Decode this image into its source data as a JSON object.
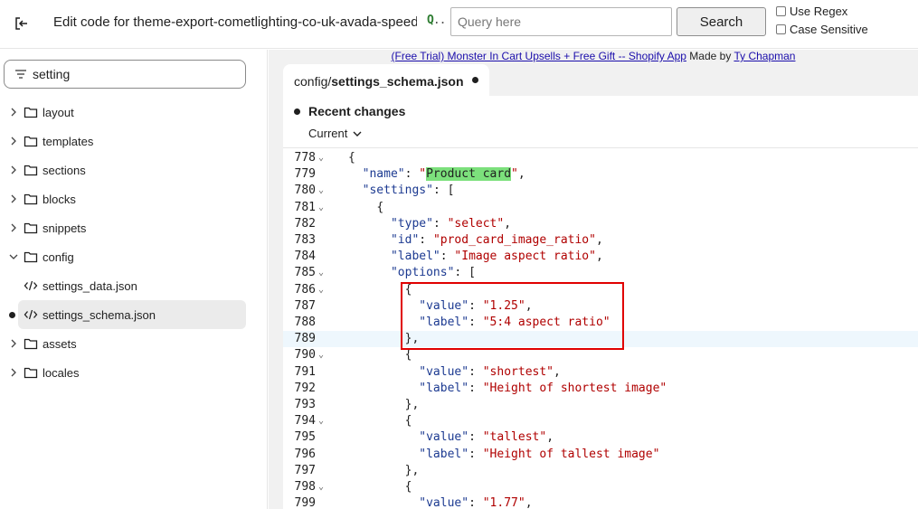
{
  "header": {
    "title": "Edit code for theme-export-cometlighting-co-uk-avada-speed-u",
    "ext_icon_q": "Q",
    "ext_icon_dots": "..",
    "query_placeholder": "Query here",
    "search_label": "Search",
    "use_regex_label": "Use Regex",
    "case_sensitive_label": "Case Sensitive"
  },
  "sidebar": {
    "filter_value": "setting",
    "items": [
      {
        "label": "layout",
        "type": "folder",
        "expanded": false
      },
      {
        "label": "templates",
        "type": "folder",
        "expanded": false
      },
      {
        "label": "sections",
        "type": "folder",
        "expanded": false
      },
      {
        "label": "blocks",
        "type": "folder",
        "expanded": false
      },
      {
        "label": "snippets",
        "type": "folder",
        "expanded": false
      },
      {
        "label": "config",
        "type": "folder",
        "expanded": true
      },
      {
        "label": "settings_data.json",
        "type": "file"
      },
      {
        "label": "settings_schema.json",
        "type": "file",
        "selected": true,
        "modified": true
      },
      {
        "label": "assets",
        "type": "folder",
        "expanded": false
      },
      {
        "label": "locales",
        "type": "folder",
        "expanded": false
      }
    ]
  },
  "banner": {
    "link1": "(Free Trial) Monster In Cart Upsells + Free Gift -- Shopify App",
    "made_by": " Made by ",
    "link2": "Ty Chapman"
  },
  "tab": {
    "path_prefix": "config/",
    "path_file": "settings_schema.json"
  },
  "recent_changes": {
    "title": "Recent changes",
    "version": "Current"
  },
  "editor": {
    "active_line": 789,
    "lines": [
      {
        "n": "778",
        "fold": true,
        "indent": "",
        "parts": [
          [
            "p",
            "{"
          ]
        ]
      },
      {
        "n": "779",
        "fold": false,
        "indent": "  ",
        "parts": [
          [
            "k",
            "\"name\""
          ],
          [
            "p",
            ": "
          ],
          [
            "s",
            "\""
          ],
          [
            "h",
            "Product card"
          ],
          [
            "s",
            "\""
          ],
          [
            "p",
            ","
          ]
        ]
      },
      {
        "n": "780",
        "fold": true,
        "indent": "  ",
        "parts": [
          [
            "k",
            "\"settings\""
          ],
          [
            "p",
            ": ["
          ]
        ]
      },
      {
        "n": "781",
        "fold": true,
        "indent": "    ",
        "parts": [
          [
            "p",
            "{"
          ]
        ]
      },
      {
        "n": "782",
        "fold": false,
        "indent": "      ",
        "parts": [
          [
            "k",
            "\"type\""
          ],
          [
            "p",
            ": "
          ],
          [
            "s",
            "\"select\""
          ],
          [
            "p",
            ","
          ]
        ]
      },
      {
        "n": "783",
        "fold": false,
        "indent": "      ",
        "parts": [
          [
            "k",
            "\"id\""
          ],
          [
            "p",
            ": "
          ],
          [
            "s",
            "\"prod_card_image_ratio\""
          ],
          [
            "p",
            ","
          ]
        ]
      },
      {
        "n": "784",
        "fold": false,
        "indent": "      ",
        "parts": [
          [
            "k",
            "\"label\""
          ],
          [
            "p",
            ": "
          ],
          [
            "s",
            "\"Image aspect ratio\""
          ],
          [
            "p",
            ","
          ]
        ]
      },
      {
        "n": "785",
        "fold": true,
        "indent": "      ",
        "parts": [
          [
            "k",
            "\"options\""
          ],
          [
            "p",
            ": ["
          ]
        ]
      },
      {
        "n": "786",
        "fold": true,
        "indent": "        ",
        "parts": [
          [
            "p",
            "{"
          ]
        ]
      },
      {
        "n": "787",
        "fold": false,
        "indent": "          ",
        "parts": [
          [
            "k",
            "\"value\""
          ],
          [
            "p",
            ": "
          ],
          [
            "s",
            "\"1.25\""
          ],
          [
            "p",
            ","
          ]
        ]
      },
      {
        "n": "788",
        "fold": false,
        "indent": "          ",
        "parts": [
          [
            "k",
            "\"label\""
          ],
          [
            "p",
            ": "
          ],
          [
            "s",
            "\"5:4 aspect ratio\""
          ]
        ]
      },
      {
        "n": "789",
        "fold": false,
        "indent": "        ",
        "parts": [
          [
            "p",
            "},"
          ]
        ]
      },
      {
        "n": "790",
        "fold": true,
        "indent": "        ",
        "parts": [
          [
            "p",
            "{"
          ]
        ]
      },
      {
        "n": "791",
        "fold": false,
        "indent": "          ",
        "parts": [
          [
            "k",
            "\"value\""
          ],
          [
            "p",
            ": "
          ],
          [
            "s",
            "\"shortest\""
          ],
          [
            "p",
            ","
          ]
        ]
      },
      {
        "n": "792",
        "fold": false,
        "indent": "          ",
        "parts": [
          [
            "k",
            "\"label\""
          ],
          [
            "p",
            ": "
          ],
          [
            "s",
            "\"Height of shortest image\""
          ]
        ]
      },
      {
        "n": "793",
        "fold": false,
        "indent": "        ",
        "parts": [
          [
            "p",
            "},"
          ]
        ]
      },
      {
        "n": "794",
        "fold": true,
        "indent": "        ",
        "parts": [
          [
            "p",
            "{"
          ]
        ]
      },
      {
        "n": "795",
        "fold": false,
        "indent": "          ",
        "parts": [
          [
            "k",
            "\"value\""
          ],
          [
            "p",
            ": "
          ],
          [
            "s",
            "\"tallest\""
          ],
          [
            "p",
            ","
          ]
        ]
      },
      {
        "n": "796",
        "fold": false,
        "indent": "          ",
        "parts": [
          [
            "k",
            "\"label\""
          ],
          [
            "p",
            ": "
          ],
          [
            "s",
            "\"Height of tallest image\""
          ]
        ]
      },
      {
        "n": "797",
        "fold": false,
        "indent": "        ",
        "parts": [
          [
            "p",
            "},"
          ]
        ]
      },
      {
        "n": "798",
        "fold": true,
        "indent": "        ",
        "parts": [
          [
            "p",
            "{"
          ]
        ]
      },
      {
        "n": "799",
        "fold": false,
        "indent": "          ",
        "parts": [
          [
            "k",
            "\"value\""
          ],
          [
            "p",
            ": "
          ],
          [
            "s",
            "\"1.77\""
          ],
          [
            "p",
            ","
          ]
        ]
      }
    ]
  },
  "colors": {
    "highlight": "#7ce07c",
    "annotation_box": "#e00000",
    "json_key": "#1c3a91",
    "json_string": "#b00000"
  }
}
